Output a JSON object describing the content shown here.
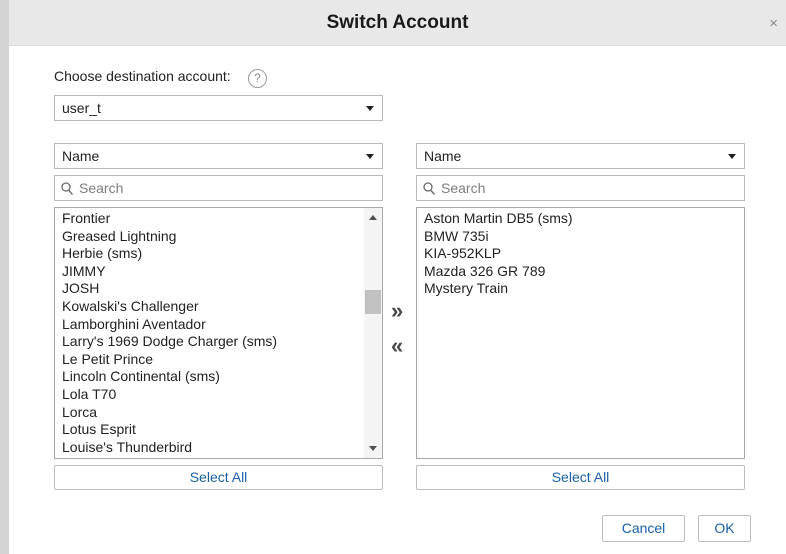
{
  "dialog": {
    "title": "Switch Account",
    "close_glyph": "×"
  },
  "destination": {
    "label": "Choose destination account:",
    "help_glyph": "?",
    "selected": "user_t"
  },
  "left_panel": {
    "sort_selected": "Name",
    "search_placeholder": "Search",
    "items": [
      "Frontier",
      "Greased Lightning",
      "Herbie (sms)",
      "JIMMY",
      "JOSH",
      "Kowalski's Challenger",
      "Lamborghini Aventador",
      "Larry's 1969 Dodge Charger (sms)",
      "Le Petit Prince",
      "Lincoln Continental (sms)",
      "Lola T70",
      "Lorca",
      "Lotus Esprit",
      "Louise's Thunderbird"
    ],
    "select_all_label": "Select All"
  },
  "right_panel": {
    "sort_selected": "Name",
    "search_placeholder": "Search",
    "items": [
      "Aston Martin DB5 (sms)",
      "BMW 735i",
      "KIA-952KLP",
      "Mazda 326 GR 789",
      "Mystery Train"
    ],
    "select_all_label": "Select All"
  },
  "transfer": {
    "move_right_glyph": "»",
    "move_left_glyph": "«"
  },
  "footer": {
    "cancel_label": "Cancel",
    "ok_label": "OK"
  },
  "colors": {
    "titlebar": "#e8e8e8",
    "link_blue": "#1a5fa8",
    "border": "#b9b9b9"
  },
  "icons": [
    "close-icon",
    "help-icon",
    "search-icon",
    "chevron-down-icon",
    "move-right-icon",
    "move-left-icon"
  ]
}
